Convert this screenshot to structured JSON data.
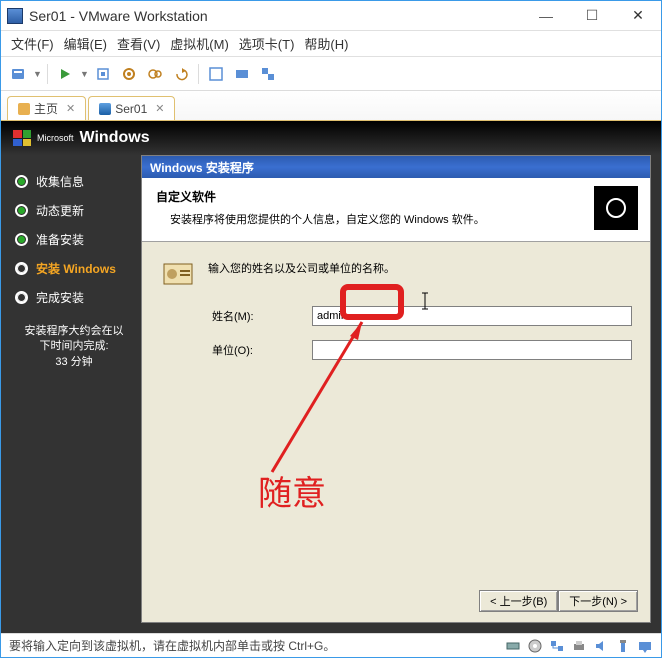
{
  "window": {
    "title": "Ser01 - VMware Workstation"
  },
  "menu": {
    "file": "文件(F)",
    "edit": "编辑(E)",
    "view": "查看(V)",
    "vm": "虚拟机(M)",
    "tabs": "选项卡(T)",
    "help": "帮助(H)"
  },
  "tabs": {
    "home": "主页",
    "vm": "Ser01"
  },
  "os_brand": "Windows",
  "os_brand_prefix": "Microsoft",
  "sidebar": {
    "steps": [
      {
        "label": "收集信息",
        "state": "done"
      },
      {
        "label": "动态更新",
        "state": "done"
      },
      {
        "label": "准备安装",
        "state": "done"
      },
      {
        "label": "安装 Windows",
        "state": "active"
      },
      {
        "label": "完成安装",
        "state": "pending"
      }
    ],
    "completion_line1": "安装程序大约会在以",
    "completion_line2": "下时间内完成:",
    "completion_line3": "33 分钟"
  },
  "wizard": {
    "titlebar": "Windows 安装程序",
    "heading": "自定义软件",
    "subheading": "安装程序将使用您提供的个人信息，自定义您的 Windows 软件。",
    "prompt": "输入您的姓名以及公司或单位的名称。",
    "name_label": "姓名(M):",
    "name_value": "admin",
    "org_label": "单位(O):",
    "org_value": "",
    "btn_back": "< 上一步(B)",
    "btn_next": "下一步(N) >"
  },
  "annotation": {
    "text": "随意"
  },
  "statusbar": {
    "text": "要将输入定向到该虚拟机，请在虚拟机内部单击或按 Ctrl+G。"
  }
}
